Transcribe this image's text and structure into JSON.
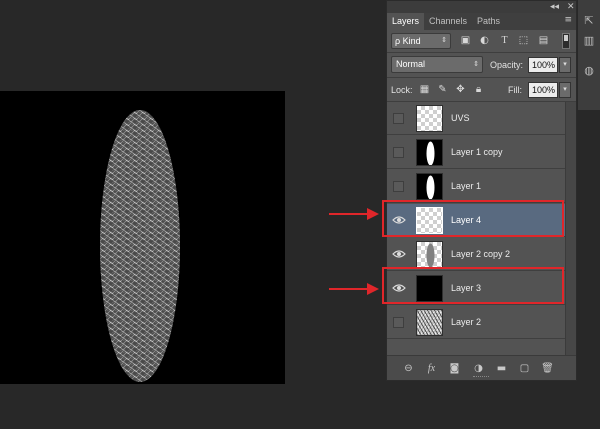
{
  "panel": {
    "collapse_glyph": "◂◂",
    "close_glyph": "✕",
    "tabs": [
      {
        "label": "Layers",
        "active": true
      },
      {
        "label": "Channels",
        "active": false
      },
      {
        "label": "Paths",
        "active": false
      }
    ],
    "menu_icon": "panel-menu-icon",
    "filter": {
      "kind_label": "ρ Kind",
      "icons": [
        "image-filter-icon",
        "adjustment-filter-icon",
        "type-filter-icon",
        "shape-filter-icon",
        "smart-object-filter-icon"
      ]
    },
    "blend_mode": "Normal",
    "opacity_label": "Opacity:",
    "opacity_value": "100%",
    "lock_label": "Lock:",
    "fill_label": "Fill:",
    "fill_value": "100%",
    "layers": [
      {
        "name": "UVS",
        "visible": false,
        "thumb": "transparent",
        "selected": false
      },
      {
        "name": "Layer 1 copy",
        "visible": false,
        "thumb": "white-ellipse",
        "selected": false
      },
      {
        "name": "Layer 1",
        "visible": false,
        "thumb": "white-ellipse",
        "selected": false
      },
      {
        "name": "Layer 4",
        "visible": true,
        "thumb": "transparent",
        "selected": true
      },
      {
        "name": "Layer 2 copy 2",
        "visible": true,
        "thumb": "gray-ellipse",
        "selected": false
      },
      {
        "name": "Layer 3",
        "visible": true,
        "thumb": "black",
        "selected": false
      },
      {
        "name": "Layer 2",
        "visible": false,
        "thumb": "noise",
        "selected": false
      }
    ],
    "bottom_icons": [
      "link-layers-icon",
      "fx-icon",
      "add-mask-icon",
      "adjustment-layer-icon",
      "new-group-icon",
      "new-layer-icon",
      "delete-layer-icon"
    ],
    "fx_label": "fx"
  },
  "colors": {
    "highlight": "#e0262a",
    "selected_row": "#596a80",
    "arrow": "#e0262a"
  }
}
